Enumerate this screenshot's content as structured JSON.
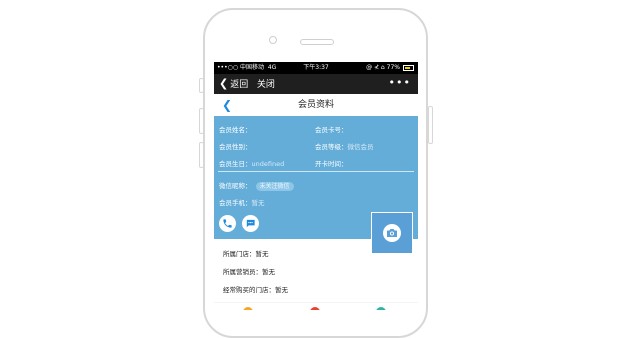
{
  "status_bar": {
    "carrier": "•••○○ 中国移动",
    "network": "4G",
    "time": "下午3:37",
    "right": "@ ⊀ ⌂ 77%",
    "battery_level": 0.77
  },
  "nav": {
    "back_label": "返回",
    "close_label": "关闭",
    "more_label": "•••"
  },
  "title_bar": {
    "title": "会员资料"
  },
  "profile": {
    "name_label": "会员姓名：",
    "card_label": "会员卡号：",
    "gender_label": "会员性别：",
    "level_label": "会员等级：",
    "level_value": "微信会员",
    "birthday_label": "会员生日：",
    "birthday_value": "undefined",
    "open_date_label": "开卡时间：",
    "wechat_label": "微信昵称：",
    "wechat_badge": "未关注微信",
    "phone_label": "会员手机：",
    "phone_value": "暂无"
  },
  "details": {
    "store": "所属门店：暂无",
    "sales": "所属营销员：暂无",
    "frequent_store": "经常购买的门店：暂无"
  },
  "colors": {
    "card_bg": "#64add8",
    "accent": "#1c8adf",
    "camera_fab": "#5a9fd6",
    "battery": "#f2d400"
  }
}
